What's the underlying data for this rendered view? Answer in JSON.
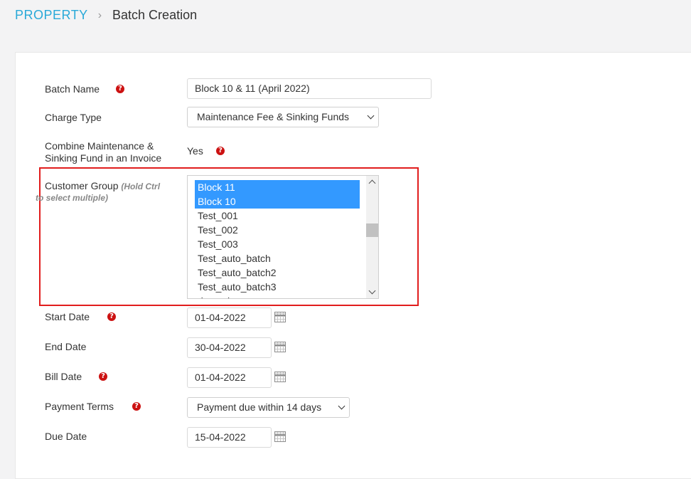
{
  "breadcrumb": {
    "root": "PROPERTY",
    "separator": "›",
    "current": "Batch Creation"
  },
  "form": {
    "batch_name": {
      "label": "Batch Name",
      "value": "Block 10 & 11 (April 2022)"
    },
    "charge_type": {
      "label": "Charge Type",
      "value": "Maintenance Fee & Sinking Funds"
    },
    "combine": {
      "label_line1": "Combine Maintenance &",
      "label_line2": "Sinking Fund in an Invoice",
      "value": "Yes"
    },
    "customer_group": {
      "label": "Customer Group",
      "hint_line1": "(Hold Ctrl",
      "hint_line2": "to select multiple)",
      "options": [
        {
          "label": "Block 11",
          "selected": true
        },
        {
          "label": "Block 10",
          "selected": true
        },
        {
          "label": "Test_001",
          "selected": false
        },
        {
          "label": "Test_002",
          "selected": false
        },
        {
          "label": "Test_003",
          "selected": false
        },
        {
          "label": "Test_auto_batch",
          "selected": false
        },
        {
          "label": "Test_auto_batch2",
          "selected": false
        },
        {
          "label": "Test_auto_batch3",
          "selected": false
        },
        {
          "label": "damasks",
          "selected": false
        }
      ]
    },
    "start_date": {
      "label": "Start Date",
      "value": "01-04-2022"
    },
    "end_date": {
      "label": "End Date",
      "value": "30-04-2022"
    },
    "bill_date": {
      "label": "Bill Date",
      "value": "01-04-2022"
    },
    "payment_terms": {
      "label": "Payment Terms",
      "value": "Payment due within 14 days"
    },
    "due_date": {
      "label": "Due Date",
      "value": "15-04-2022"
    }
  },
  "icons": {
    "help": "question-circle-icon",
    "calendar": "calendar-icon",
    "dropdown": "chevron-down-icon"
  },
  "colors": {
    "link": "#29a9d8",
    "help": "#cc1111",
    "selection": "#3399ff",
    "highlight_border": "#e11d1d"
  }
}
